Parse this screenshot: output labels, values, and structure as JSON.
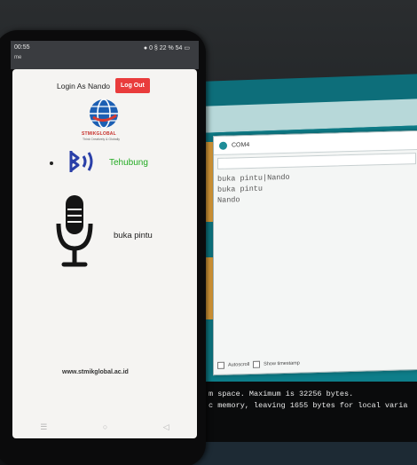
{
  "phone": {
    "status_time": "00:55",
    "status_right": "● 0 § 22 % 54 ▭",
    "status_sub": "me",
    "login_label": "Login As Nando",
    "logout_label": "Log Out",
    "logo_name": "STMIKGLOBAL",
    "logo_tagline": "Think Creatively & Globally",
    "bluetooth_status": "Tehubung",
    "voice_result": "buka pintu",
    "website": "www.stmikglobal.ac.id",
    "nav_icons": [
      "recents-icon",
      "home-icon",
      "back-icon"
    ],
    "colors": {
      "logout": "#e93c3c",
      "connected": "#22aa22"
    }
  },
  "serial_monitor": {
    "title": "COM4",
    "output_lines": [
      "buka pintu|Nando",
      "buka pintu",
      "Nando"
    ],
    "autoscroll_label": "Autoscroll",
    "timestamp_label": "Show timestamp"
  },
  "console": {
    "lines": [
      "m space. Maximum is 32256 bytes.",
      "c memory, leaving 1655 bytes for local varia"
    ]
  }
}
